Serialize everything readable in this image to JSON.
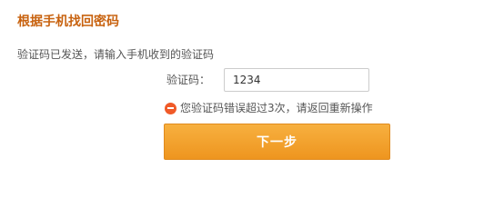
{
  "page": {
    "title": "根据手机找回密码",
    "instruction": "验证码已发送，请输入手机收到的验证码"
  },
  "form": {
    "code_label": "验证码：",
    "code_value": "1234",
    "error_message": "您验证码错误超过3次，请返回重新操作",
    "next_label": "下一步"
  },
  "icons": {
    "error": "minus-circle-icon"
  },
  "colors": {
    "title": "#c8620f",
    "button": "#f2a22e",
    "error_icon": "#f05a28"
  }
}
